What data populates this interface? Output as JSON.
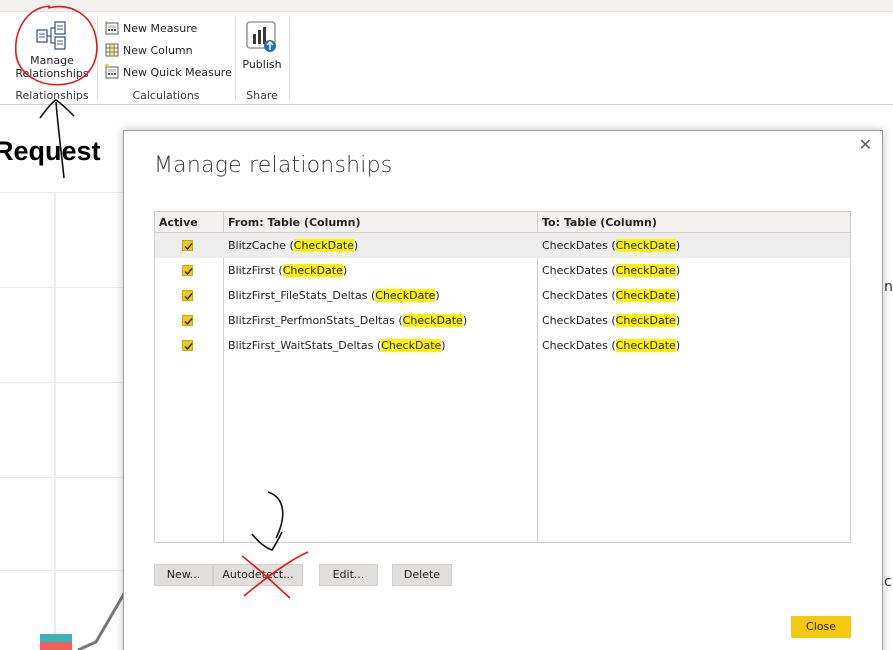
{
  "ribbon": {
    "relationships": {
      "button_label_1": "Manage",
      "button_label_2": "Relationships",
      "group_label": "Relationships"
    },
    "calculations": {
      "new_measure": "New Measure",
      "new_column": "New Column",
      "new_quick_measure": "New Quick Measure",
      "group_label": "Calculations"
    },
    "share": {
      "publish": "Publish",
      "group_label": "Share"
    }
  },
  "report": {
    "title_fragment": "Request",
    "edge_chars": [
      "n",
      "c"
    ]
  },
  "dialog": {
    "title": "Manage relationships",
    "close_glyph": "✕",
    "columns": {
      "active": "Active",
      "from": "From: Table (Column)",
      "to": "To: Table (Column)"
    },
    "rows": [
      {
        "active": true,
        "from_table": "BlitzCache",
        "from_column": "CheckDate",
        "to_table": "CheckDates",
        "to_column": "CheckDate"
      },
      {
        "active": true,
        "from_table": "BlitzFirst",
        "from_column": "CheckDate",
        "to_table": "CheckDates",
        "to_column": "CheckDate"
      },
      {
        "active": true,
        "from_table": "BlitzFirst_FileStats_Deltas",
        "from_column": "CheckDate",
        "to_table": "CheckDates",
        "to_column": "CheckDate"
      },
      {
        "active": true,
        "from_table": "BlitzFirst_PerfmonStats_Deltas",
        "from_column": "CheckDate",
        "to_table": "CheckDates",
        "to_column": "CheckDate"
      },
      {
        "active": true,
        "from_table": "BlitzFirst_WaitStats_Deltas",
        "from_column": "CheckDate",
        "to_table": "CheckDates",
        "to_column": "CheckDate"
      }
    ],
    "buttons": {
      "new": "New...",
      "autodetect": "Autodetect...",
      "edit": "Edit...",
      "delete": "Delete",
      "close": "Close"
    }
  },
  "colors": {
    "accent_yellow": "#f2c811",
    "highlight": "#fff200",
    "annotation_red": "#e8141b"
  }
}
